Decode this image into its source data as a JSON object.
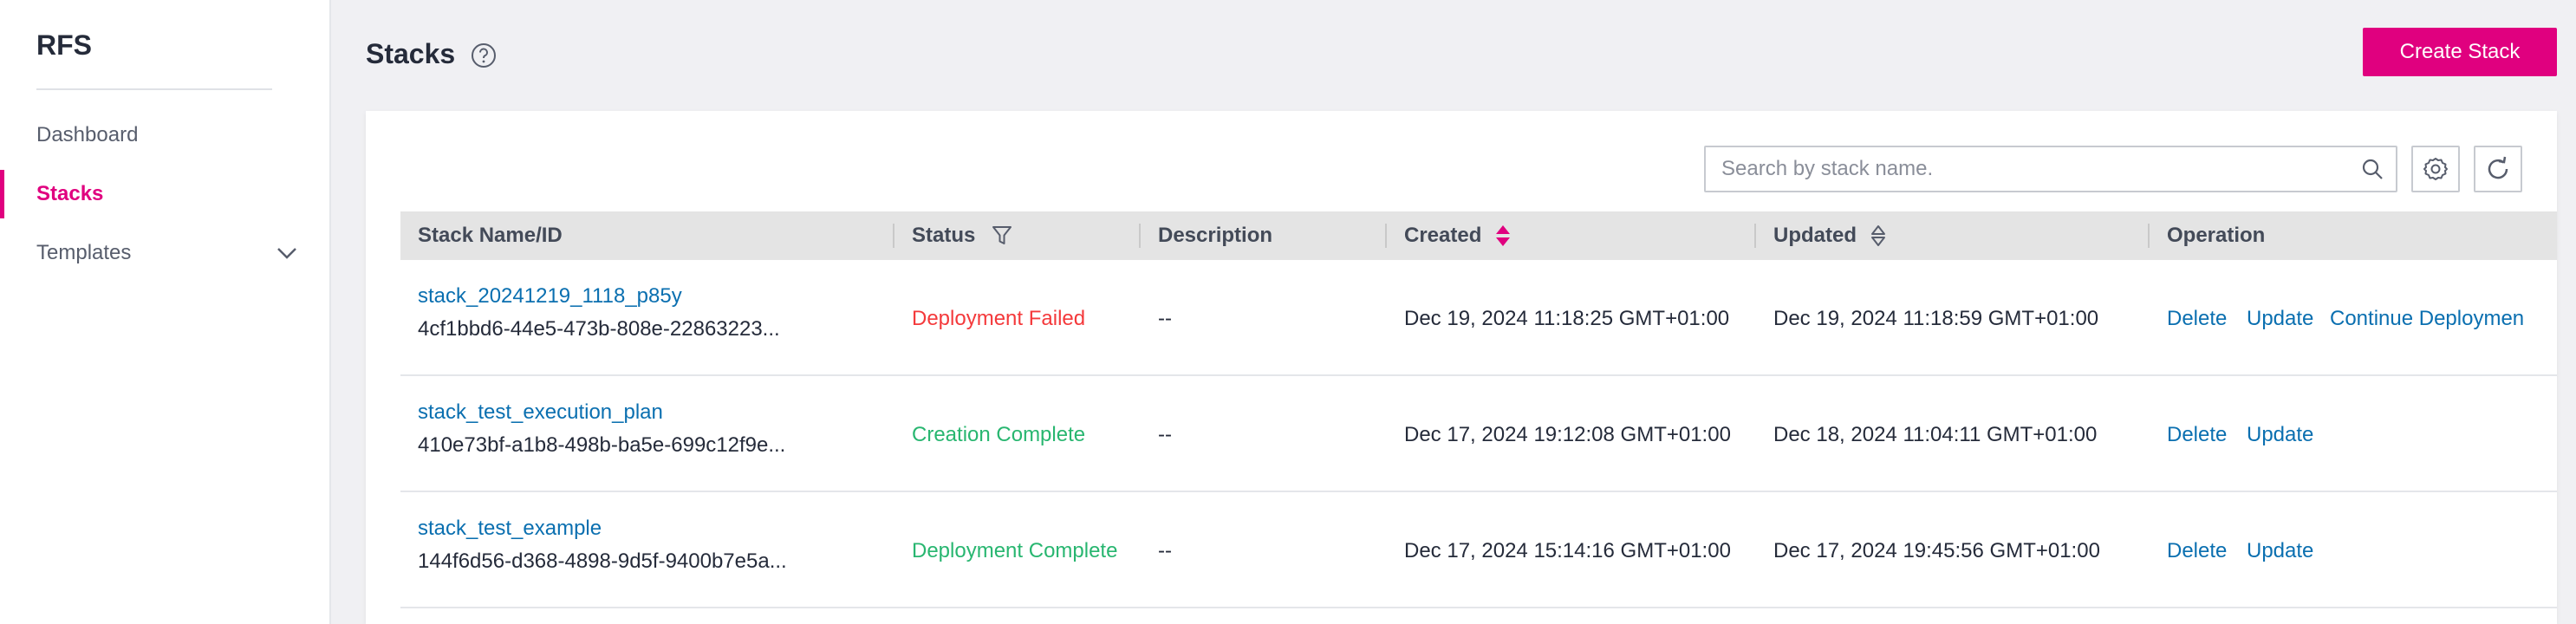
{
  "sidebar": {
    "logo": "RFS",
    "items": [
      {
        "label": "Dashboard"
      },
      {
        "label": "Stacks"
      },
      {
        "label": "Templates"
      }
    ]
  },
  "header": {
    "title": "Stacks",
    "create_button": "Create Stack"
  },
  "toolbar": {
    "search_placeholder": "Search by stack name."
  },
  "table": {
    "columns": {
      "name": "Stack Name/ID",
      "status": "Status",
      "description": "Description",
      "created": "Created",
      "updated": "Updated",
      "operation": "Operation"
    },
    "rows": [
      {
        "name": "stack_20241219_1118_p85y",
        "id": "4cf1bbd6-44e5-473b-808e-22863223...",
        "status": "Deployment Failed",
        "description": "--",
        "created": "Dec 19, 2024 11:18:25 GMT+01:00",
        "updated": "Dec 19, 2024 11:18:59 GMT+01:00",
        "ops": [
          "Delete",
          "Update",
          "Continue Deploymen"
        ]
      },
      {
        "name": "stack_test_execution_plan",
        "id": "410e73bf-a1b8-498b-ba5e-699c12f9e...",
        "status": "Creation Complete",
        "description": "--",
        "created": "Dec 17, 2024 19:12:08 GMT+01:00",
        "updated": "Dec 18, 2024 11:04:11 GMT+01:00",
        "ops": [
          "Delete",
          "Update"
        ]
      },
      {
        "name": "stack_test_example",
        "id": "144f6d56-d368-4898-9d5f-9400b7e5a...",
        "status": "Deployment Complete",
        "description": "--",
        "created": "Dec 17, 2024 15:14:16 GMT+01:00",
        "updated": "Dec 17, 2024 19:45:56 GMT+01:00",
        "ops": [
          "Delete",
          "Update"
        ]
      }
    ]
  },
  "colors": {
    "accent": "#e0007f",
    "link": "#0a6fb0",
    "failed": "#f4393b",
    "complete": "#28b670"
  }
}
